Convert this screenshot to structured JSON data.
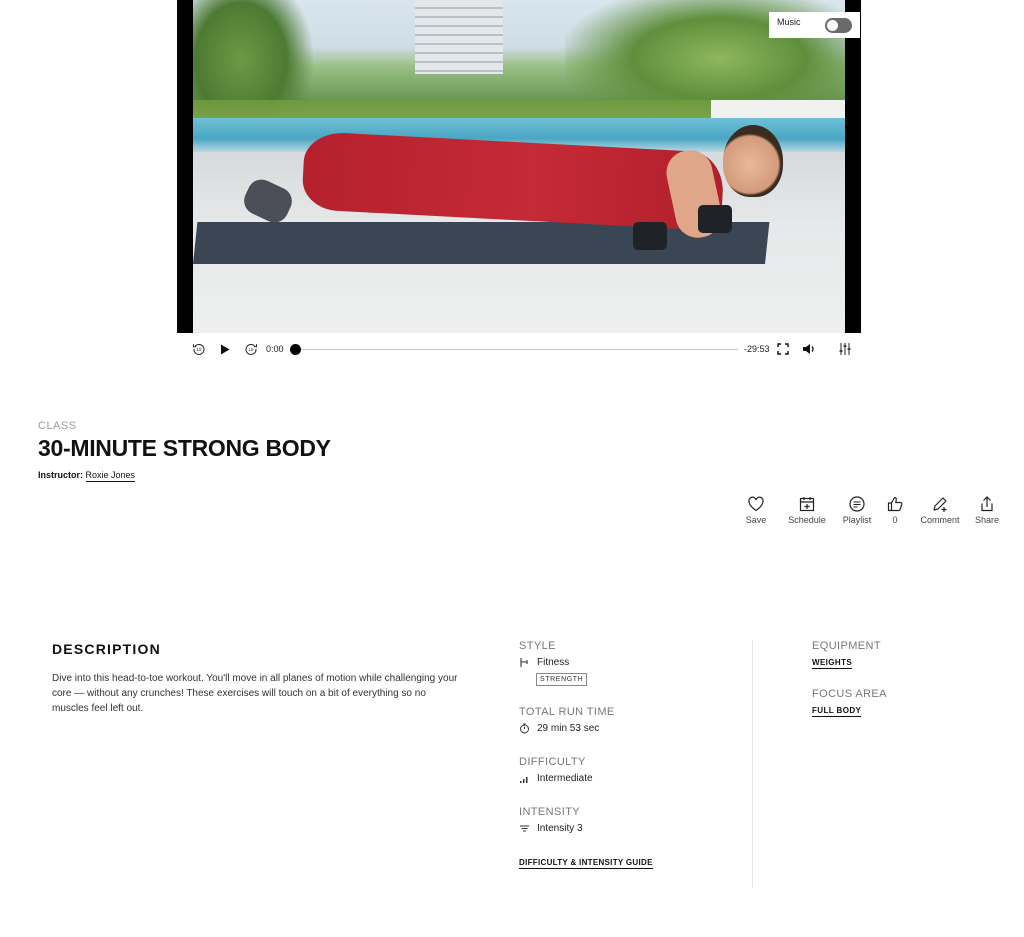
{
  "video": {
    "music_label": "Music",
    "music_on": false,
    "time_current": "0:00",
    "time_remaining": "-29:53",
    "progress": 0.0
  },
  "class": {
    "kicker": "CLASS",
    "title": "30-MINUTE STRONG BODY",
    "instructor_label": "Instructor:",
    "instructor_name": "Roxie Jones"
  },
  "actions": {
    "save": "Save",
    "schedule": "Schedule",
    "playlist": "Playlist",
    "like_count": "0",
    "comment": "Comment",
    "share": "Share"
  },
  "description": {
    "heading": "DESCRIPTION",
    "text": "Dive into this head-to-toe workout. You'll move in all planes of motion while challenging your core — without any crunches! These exercises will touch on a bit of everything so no muscles feel left out."
  },
  "details": {
    "style_label": "STYLE",
    "style_value": "Fitness",
    "style_tag": "STRENGTH",
    "runtime_label": "TOTAL RUN TIME",
    "runtime_value": "29 min 53 sec",
    "difficulty_label": "DIFFICULTY",
    "difficulty_value": "Intermediate",
    "intensity_label": "INTENSITY",
    "intensity_value": "Intensity 3",
    "guide_link": "DIFFICULTY & INTENSITY GUIDE",
    "equipment_label": "EQUIPMENT",
    "equipment_value": "WEIGHTS",
    "focus_label": "FOCUS AREA",
    "focus_value": "FULL BODY"
  },
  "icons": {
    "skip_back": "skip-back-15-icon",
    "play": "play-icon",
    "skip_forward": "skip-forward-15-icon",
    "fullscreen": "fullscreen-icon",
    "volume": "volume-icon",
    "settings": "sliders-icon",
    "save": "heart-icon",
    "schedule": "calendar-plus-icon",
    "playlist": "playlist-icon",
    "like": "thumbs-up-icon",
    "comment": "pencil-plus-icon",
    "share": "share-icon"
  }
}
